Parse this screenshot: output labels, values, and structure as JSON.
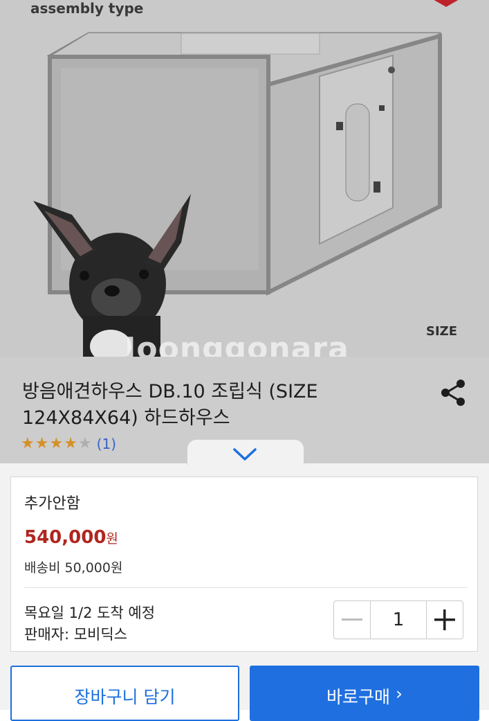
{
  "hero": {
    "top_label": "assembly type",
    "size_label": "SIZE",
    "watermark": "Joonggonara"
  },
  "product": {
    "title": "방음애견하우스 DB.10 조립식 (SIZE 124X84X64) 하드하우스",
    "rating": 4,
    "rating_max": 5,
    "review_count": "(1)"
  },
  "colors": {
    "price": "#b0261f",
    "primary": "#1f6fe0",
    "star": "#e39b2a",
    "link": "#3a6ad8"
  },
  "option": {
    "name": "추가안함",
    "price": "540,000",
    "price_unit": "원",
    "shipping": "배송비 50,000원",
    "delivery": "목요일 1/2 도착 예정",
    "seller": "판매자: 모비딕스",
    "quantity": "1"
  },
  "actions": {
    "cart_label": "장바구니 담기",
    "buy_label": "바로구매",
    "buy_arrow": "›"
  },
  "icons": {
    "share": "share-icon",
    "collapse": "chevron-down-icon",
    "minus": "minus-icon",
    "plus": "plus-icon"
  }
}
